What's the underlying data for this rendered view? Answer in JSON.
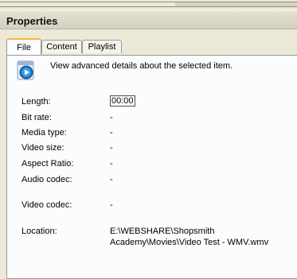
{
  "window": {
    "title": "Properties"
  },
  "tabs": [
    {
      "label": "File",
      "active": true
    },
    {
      "label": "Content",
      "active": false
    },
    {
      "label": "Playlist",
      "active": false
    }
  ],
  "description": "View advanced details about the selected item.",
  "properties": [
    {
      "label": "Length:",
      "value": "00:00"
    },
    {
      "label": "Bit rate:",
      "value": "-"
    },
    {
      "label": "Media type:",
      "value": "-"
    },
    {
      "label": "Video size:",
      "value": "-"
    },
    {
      "label": "Aspect Ratio:",
      "value": "-"
    },
    {
      "label": "Audio codec:",
      "value": "-"
    },
    {
      "label": "Video codec:",
      "value": "-"
    },
    {
      "label": "Location:",
      "value_line1": "E:\\WEBSHARE\\Shopsmith",
      "value_line2": "Academy\\Movies\\Video Test - WMV.wmv"
    }
  ],
  "icons": {
    "media": "windows-media-player-icon"
  },
  "colors": {
    "background": "#ece9d8",
    "panel": "#fcfcfe",
    "active_tab_accent": "#f2b53a"
  }
}
